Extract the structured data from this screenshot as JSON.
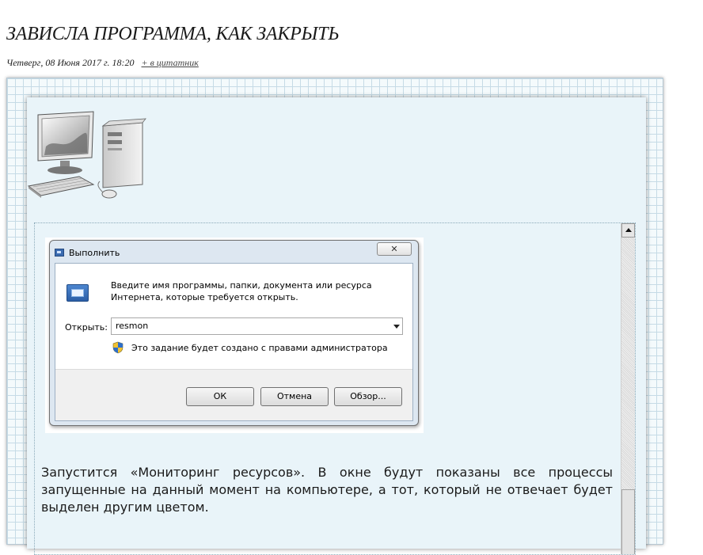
{
  "post": {
    "title": "ЗАВИСЛА ПРОГРАММА, КАК ЗАКРЫТЬ",
    "date": "Четверг, 08 Июня 2017 г. 18:20",
    "quote_link": "+ в цитатник"
  },
  "run_dialog": {
    "title": "Выполнить",
    "close_label": "✕",
    "description": "Введите имя программы, папки, документа или ресурса Интернета, которые требуется открыть.",
    "open_label": "Открыть:",
    "input_value": "resmon",
    "admin_note": "Это задание будет создано с правами администратора",
    "ok_label": "ОК",
    "cancel_label": "Отмена",
    "browse_label": "Обзор..."
  },
  "article_text": "Запустится «Мониторинг ресурсов». В окне будут показаны все процессы запущенные на данный момент на компьютере, а тот, который не отвечает будет выделен другим цветом.",
  "icons": [
    "computer-illustration",
    "run-icon",
    "shield-icon",
    "close-icon",
    "chevron-down-icon",
    "scroll-up-arrow-icon"
  ]
}
